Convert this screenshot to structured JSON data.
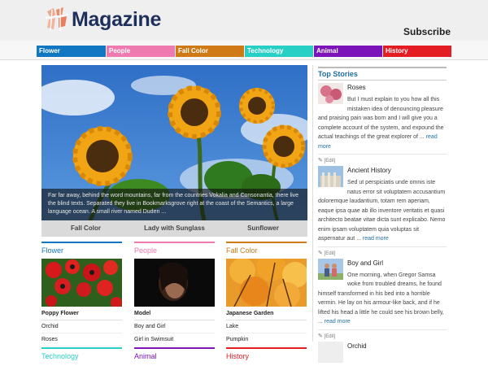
{
  "site": {
    "logo_text": "Magazine",
    "subscribe": "Subscribe"
  },
  "nav": [
    {
      "label": "Flower",
      "color": "#1177c2"
    },
    {
      "label": "People",
      "color": "#ee7aaf"
    },
    {
      "label": "Fall Color",
      "color": "#cf7a17"
    },
    {
      "label": "Technology",
      "color": "#27cfc5"
    },
    {
      "label": "Animal",
      "color": "#7b14b9"
    },
    {
      "label": "History",
      "color": "#e41c24"
    }
  ],
  "hero": {
    "caption": "Far far away, behind the word mountains, far from the countries Vokalia and Consonantia, there live the blind texts. Separated they live in Bookmarksgrove right at the coast of the Semantics, a large language ocean. A small river named Duden ...",
    "tabs": [
      "Fall Color",
      "Lady with Sunglass",
      "Sunflower"
    ]
  },
  "categories": [
    {
      "title": "Flower",
      "color": "#1177c2",
      "feature": "Poppy Flower",
      "items": [
        "Orchid",
        "Roses"
      ]
    },
    {
      "title": "People",
      "color": "#ee7aaf",
      "feature": "Model",
      "items": [
        "Boy and Girl",
        "Girl in Swimsuit"
      ]
    },
    {
      "title": "Fall Color",
      "color": "#cf7a17",
      "feature": "Japanese Garden",
      "items": [
        "Lake",
        "Pumpkin"
      ]
    }
  ],
  "categories_more": [
    {
      "title": "Technology",
      "color": "#27cfc5"
    },
    {
      "title": "Animal",
      "color": "#7b14b9"
    },
    {
      "title": "History",
      "color": "#e41c24"
    }
  ],
  "sidebar": {
    "heading": "Top Stories",
    "edit_label": "[Edit]",
    "more": "read more",
    "stories": [
      {
        "title": "Roses",
        "text": "But I must explain to you how all this mistaken idea of denouncing pleasure and praising pain was born and I will give you a complete account of the system, and expound the actual teachings of the great explorer of ..."
      },
      {
        "title": "Ancient History",
        "text": "Sed ut perspiciatis unde omnis iste natus error sit voluptatem accusantium doloremque laudantium, totam rem aperiam, eaque ipsa quae ab illo inventore veritatis et quasi architecto beatae vitae dicta sunt explicabo. Nemo enim ipsam voluptatem quia voluptas sit aspernatur aut ..."
      },
      {
        "title": "Boy and Girl",
        "text": "One morning, when Gregor Samsa woke from troubled dreams, he found himself transformed in his bed into a horrible vermin. He lay on his armour-like back, and if he lifted his head a little he could see his brown belly, ..."
      },
      {
        "title": "Orchid",
        "text": ""
      }
    ]
  }
}
